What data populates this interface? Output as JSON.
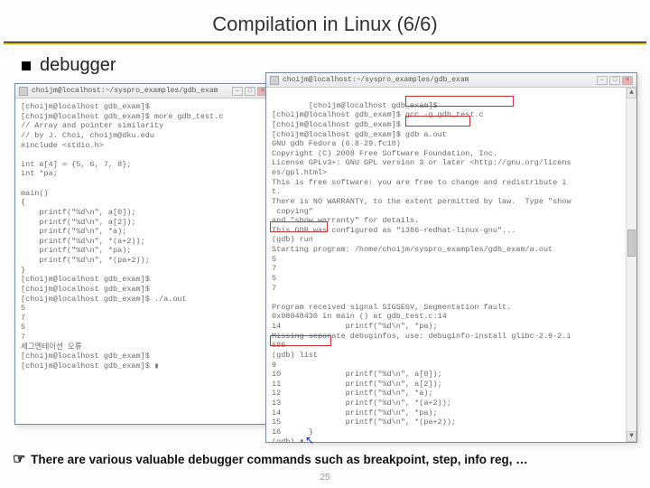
{
  "title": "Compilation in Linux (6/6)",
  "bullet": "debugger",
  "page_number": "25",
  "footer_pointer": "☞",
  "footer_text": "There are various valuable debugger commands such as breakpoint, step, info reg, …",
  "left_term": {
    "titlebar": "choijm@localhost:~/syspro_examples/gdb_exam",
    "btn_min": "–",
    "btn_max": "□",
    "btn_close": "×",
    "body": "[choijm@localhost gdb_exam]$\n[choijm@localhost gdb_exam]$ more gdb_test.c\n// Array and pointer similarity\n// by J. Choi, choijm@dku.edu\n#include <stdio.h>\n\nint a[4] = {5, 6, 7, 8};\nint *pa;\n\nmain()\n{\n    printf(\"%d\\n\", a[0]);\n    printf(\"%d\\n\", a[2]);\n    printf(\"%d\\n\", *a);\n    printf(\"%d\\n\", *(a+2));\n    printf(\"%d\\n\", *pa);\n    printf(\"%d\\n\", *(pa+2));\n}\n[choijm@localhost gdb_exam]$\n[choijm@localhost gdb_exam]$\n[choijm@localhost gdb_exam]$ ./a.out\n5\n7\n5\n7\n세그멘테이션 오류\n[choijm@localhost gdb_exam]$\n[choijm@localhost gdb_exam]$ ▮"
  },
  "right_term": {
    "titlebar": "choijm@localhost:~/syspro_examples/gdb_exam",
    "btn_min": "–",
    "btn_max": "□",
    "btn_close": "×",
    "body": "[choijm@localhost gdb_exam]$\n[choijm@localhost gdb_exam]$ gcc -g gdb_test.c\n[choijm@localhost gdb_exam]$\n[choijm@localhost gdb_exam]$ gdb a.out\nGNU gdb Fedora (6.8-29.fc10)\nCopyright (C) 2008 Free Software Foundation, Inc.\nLicense GPLv3+: GNU GPL version 3 or later <http://gnu.org/licens\nes/gpl.html>\nThis is free software: you are free to change and redistribute i\nt.\nThere is NO WARRANTY, to the extent permitted by law.  Type \"show\n copying\"\nand \"show warranty\" for details.\nThis GDB was configured as \"i386-redhat-linux-gnu\"...\n(gdb) run\nStarting program: /home/choijm/syspro_examples/gdb_exam/a.out\n5\n7\n5\n7\n\nProgram received signal SIGSEGV, Segmentation fault.\n0x08048430 in main () at gdb_test.c:14\n14              printf(\"%d\\n\", *pa);\nMissing separate debuginfos, use: debuginfo-install glibc-2.9-2.i\n686\n(gdb) list\n9\n10              printf(\"%d\\n\", a[0]);\n11              printf(\"%d\\n\", a[2]);\n12              printf(\"%d\\n\", *a);\n13              printf(\"%d\\n\", *(a+2));\n14              printf(\"%d\\n\", *pa);\n15              printf(\"%d\\n\", *(pa+2));\n16      }\n(gdb) ▮"
  },
  "highlights": {
    "box1_desc": "gcc -g gdb_test.c",
    "box2_desc": "gdb a.out",
    "box3_desc": "(gdb) run",
    "box4_desc": "(gdb) list"
  }
}
